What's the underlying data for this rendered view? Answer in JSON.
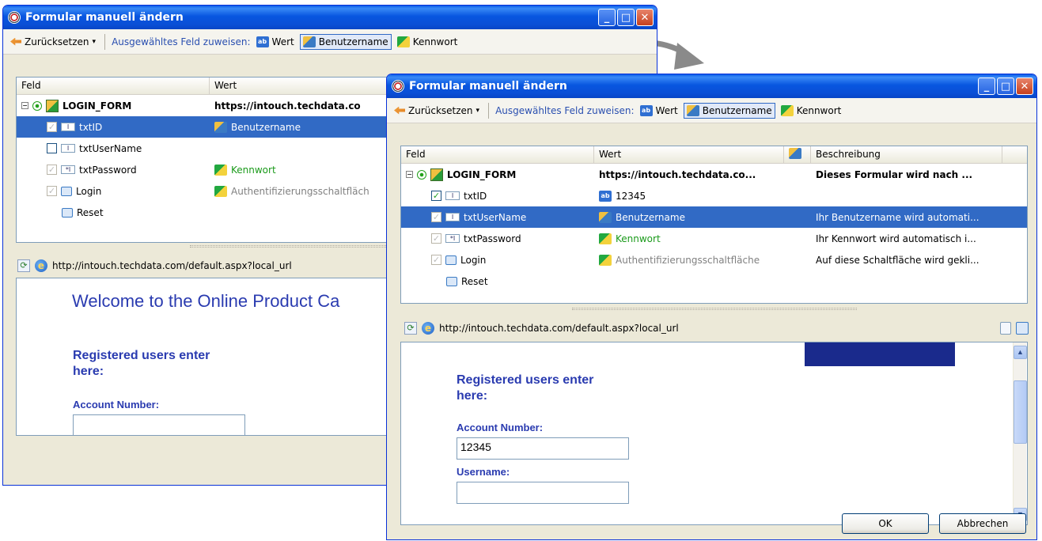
{
  "window": {
    "title": "Formular manuell ändern",
    "buttons": {
      "min": "_",
      "max": "□",
      "close": "✕"
    }
  },
  "toolbar": {
    "reset": "Zurücksetzen",
    "assign": "Ausgewähltes Feld zuweisen:",
    "wert": "Wert",
    "benutzername": "Benutzername",
    "kennwort": "Kennwort"
  },
  "columns": {
    "feld": "Feld",
    "wert": "Wert",
    "beschreibung": "Beschreibung"
  },
  "tree_back": [
    {
      "name": "LOGIN_FORM",
      "value": "https://intouch.techdata.co"
    },
    {
      "name": "txtID",
      "value": "Benutzername"
    },
    {
      "name": "txtUserName",
      "value": ""
    },
    {
      "name": "txtPassword",
      "value": "Kennwort"
    },
    {
      "name": "Login",
      "value": "Authentifizierungsschaltfläch"
    },
    {
      "name": "Reset",
      "value": ""
    }
  ],
  "tree_front": [
    {
      "name": "LOGIN_FORM",
      "value": "https://intouch.techdata.co...",
      "desc": "Dieses Formular wird nach ..."
    },
    {
      "name": "txtID",
      "value": "12345",
      "desc": ""
    },
    {
      "name": "txtUserName",
      "value": "Benutzername",
      "desc": "Ihr Benutzername wird automati..."
    },
    {
      "name": "txtPassword",
      "value": "Kennwort",
      "desc": "Ihr Kennwort wird automatisch i..."
    },
    {
      "name": "Login",
      "value": "Authentifizierungsschaltfläche",
      "desc": "Auf diese Schaltfläche wird gekli..."
    },
    {
      "name": "Reset",
      "value": "",
      "desc": ""
    }
  ],
  "address": "http://intouch.techdata.com/default.aspx?local_url",
  "page": {
    "welcome": "Welcome to the Online Product Ca",
    "registered": "Registered users enter here:",
    "account_label": "Account Number:",
    "account_value": "12345",
    "username_label": "Username:"
  },
  "dialog": {
    "ok": "OK",
    "cancel": "Abbrechen"
  },
  "colors": {
    "selection": "#316ac5",
    "title": "#0a56e0",
    "link": "#2a3bb0"
  }
}
